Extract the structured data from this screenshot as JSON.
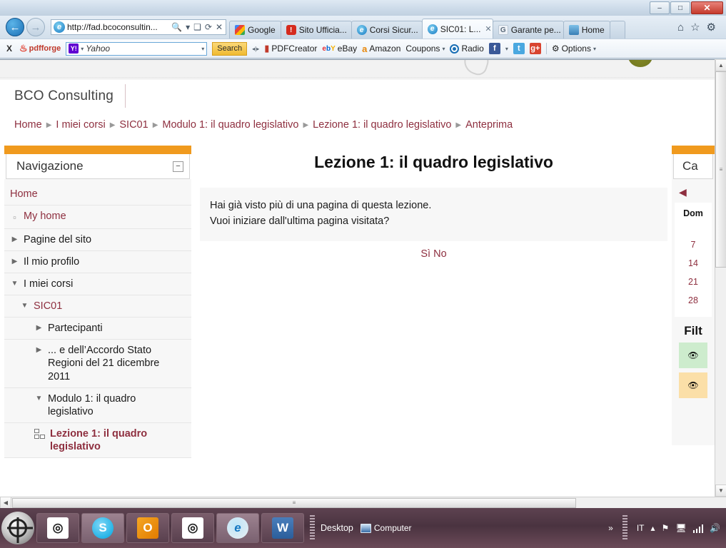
{
  "window": {
    "minimize_label": "–",
    "maximize_label": "□",
    "close_label": "✕"
  },
  "browser": {
    "back_icon": "←",
    "forward_icon": "→",
    "address": {
      "url": "http://fad.bcoconsultin...",
      "search_icon": "🔍",
      "dropdown_icon": "▾",
      "compat_icon": "❑",
      "refresh_icon": "⟳",
      "stop_icon": "✕"
    },
    "tabs": [
      {
        "label": "Google",
        "favicon": "google-icon",
        "active": false
      },
      {
        "label": "Sito Ufficia...",
        "favicon": "sito-icon",
        "active": false
      },
      {
        "label": "Corsi Sicur...",
        "favicon": "ie-icon",
        "active": false
      },
      {
        "label": "SIC01: L...",
        "favicon": "ie-icon",
        "active": true,
        "close_label": "✕"
      },
      {
        "label": "Garante pe...",
        "favicon": "garante-icon",
        "active": false
      },
      {
        "label": "Home",
        "favicon": "home-icon",
        "active": false
      }
    ],
    "right_icons": {
      "home": "⌂",
      "favorites": "☆",
      "tools": "⚙"
    }
  },
  "toolbar": {
    "close_label": "X",
    "brand": "pdfforge",
    "search": {
      "engine_logo": "Y!",
      "value": "Yahoo",
      "placeholder": "Yahoo",
      "dropdown_icon": "▾",
      "button_label": "Search"
    },
    "items": [
      {
        "label": "PDFCreator",
        "icon": "pdf-icon"
      },
      {
        "label": "eBay",
        "icon": "ebay-icon"
      },
      {
        "label": "Amazon",
        "icon": "amazon-icon"
      },
      {
        "label": "Coupons",
        "icon": "coupons-caret",
        "caret": "▾"
      },
      {
        "label": "Radio",
        "icon": "radio-icon"
      }
    ],
    "social": [
      {
        "label": "f",
        "name": "facebook-icon"
      },
      {
        "label": "▾",
        "name": "facebook-caret"
      },
      {
        "label": "t",
        "name": "twitter-icon"
      },
      {
        "label": "g+",
        "name": "googleplus-icon"
      }
    ],
    "options_label": "Options",
    "options_caret": "▾"
  },
  "page": {
    "site_name": "BCO Consulting",
    "breadcrumb": {
      "separator": "▶",
      "items": [
        {
          "label": "Home",
          "link": true
        },
        {
          "label": "I miei corsi",
          "link": true
        },
        {
          "label": "SIC01",
          "link": true
        },
        {
          "label": "Modulo 1: il quadro legislativo",
          "link": true
        },
        {
          "label": "Lezione 1: il quadro legislativo",
          "link": true
        },
        {
          "label": "Anteprima",
          "link": true
        }
      ]
    },
    "navigation_block": {
      "title": "Navigazione",
      "collapse_label": "−",
      "items": [
        {
          "label": "Home",
          "twisty": "none",
          "style": "link",
          "indent": 0
        },
        {
          "label": "My home",
          "twisty": "dot",
          "style": "link",
          "indent": 0
        },
        {
          "label": "Pagine del sito",
          "twisty": "right",
          "style": "plain",
          "indent": 0
        },
        {
          "label": "Il mio profilo",
          "twisty": "right",
          "style": "plain",
          "indent": 0
        },
        {
          "label": "I miei corsi",
          "twisty": "down",
          "style": "plain",
          "indent": 0
        },
        {
          "label": "SIC01",
          "twisty": "down",
          "style": "link",
          "indent": 1
        },
        {
          "label": "Partecipanti",
          "twisty": "right",
          "style": "plain",
          "indent": 2
        },
        {
          "label": "... e dell’Accordo Stato Regioni del 21 dicembre 2011",
          "twisty": "right",
          "style": "plain",
          "indent": 2
        },
        {
          "label": "Modulo 1: il quadro legislativo",
          "twisty": "down",
          "style": "plain",
          "indent": 2
        },
        {
          "label": "Lezione 1: il quadro legislativo",
          "twisty": "lesson",
          "style": "current",
          "indent": 3
        }
      ]
    },
    "main": {
      "title": "Lezione 1: il quadro legislativo",
      "message_line1": "Hai già visto più di una pagina di questa lezione.",
      "message_line2": "Vuoi iniziare dall'ultima pagina visitata?",
      "answer_yes": "Sì",
      "answer_no": "No"
    },
    "calendar_block": {
      "title": "Ca",
      "prev_icon": "◀",
      "day_header": "Dom",
      "days": [
        "7",
        "14",
        "21",
        "28"
      ],
      "filter_title": "Filt",
      "filters": [
        {
          "icon": "👁",
          "color": "#cdeccd"
        },
        {
          "icon": "👁",
          "color": "#fbdfa8"
        }
      ]
    }
  },
  "scrollbars": {
    "up_arrow": "▲",
    "down_arrow": "▼",
    "left_arrow": "◀",
    "right_arrow": "▶",
    "grip": "≡"
  },
  "taskbar": {
    "buttons": [
      {
        "name": "taskbar-item-target1",
        "icon": "target-icon"
      },
      {
        "name": "taskbar-item-skype",
        "icon": "skype-icon",
        "label": "S"
      },
      {
        "name": "taskbar-item-outlook",
        "icon": "outlook-icon",
        "label": "O"
      },
      {
        "name": "taskbar-item-target2",
        "icon": "target-icon"
      },
      {
        "name": "taskbar-item-ie",
        "icon": "ie-icon",
        "label": "e"
      },
      {
        "name": "taskbar-item-word",
        "icon": "word-icon",
        "label": "W"
      }
    ],
    "desktop_label": "Desktop",
    "computer_label": "Computer",
    "overflow_icon": "»",
    "language": "IT",
    "tray_up_icon": "▴",
    "flag_icon": "⚑",
    "action_icon": "⚑",
    "volume_icon": "🔊"
  },
  "colors": {
    "accent_orange": "#f09a1e",
    "link_maroon": "#8e2f3f",
    "taskbar": "#5d4250"
  }
}
